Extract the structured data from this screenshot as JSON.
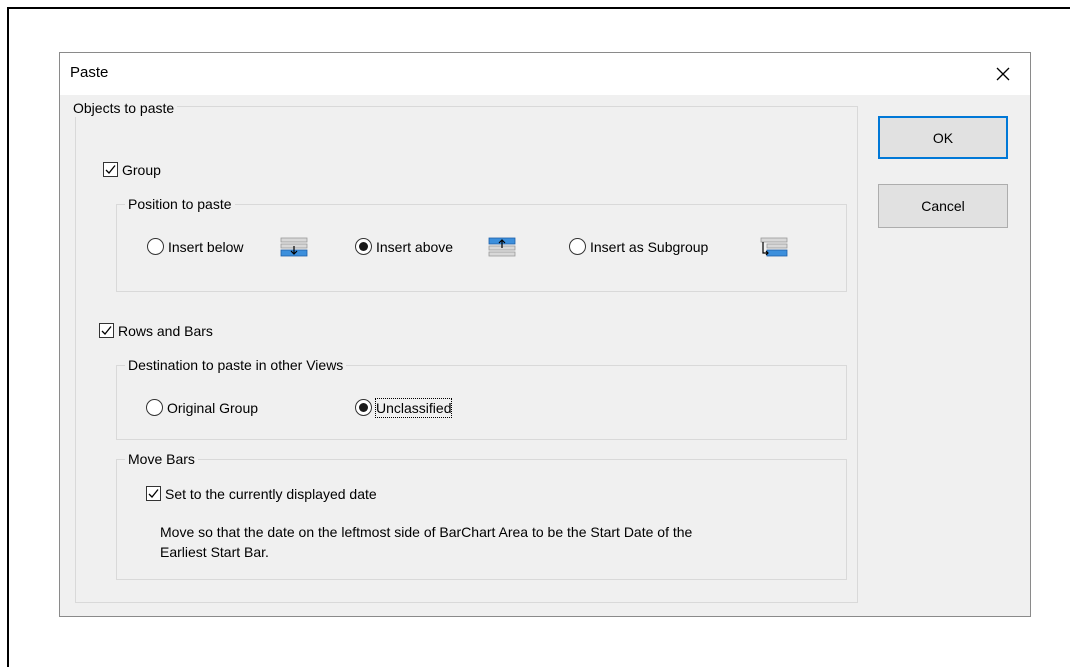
{
  "dialog": {
    "title": "Paste",
    "close_label": "×"
  },
  "objects_to_paste": {
    "legend": "Objects to paste",
    "group": {
      "checkbox_label": "Group",
      "checked": true,
      "position_legend": "Position to paste",
      "options": [
        {
          "label": "Insert below",
          "selected": false,
          "icon": "insert-below-icon"
        },
        {
          "label": "Insert above",
          "selected": true,
          "icon": "insert-above-icon"
        },
        {
          "label": "Insert as Subgroup",
          "selected": false,
          "icon": "insert-subgroup-icon"
        }
      ]
    },
    "rows_and_bars": {
      "checkbox_label": "Rows and Bars",
      "checked": true,
      "destination_legend": "Destination to paste in other Views",
      "destination_options": [
        {
          "label": "Original Group",
          "selected": false
        },
        {
          "label": "Unclassified",
          "selected": true
        }
      ],
      "move_bars": {
        "legend": "Move Bars",
        "checkbox_label": "Set to the currently displayed date",
        "checked": true,
        "description_line1": "Move so that the date on the leftmost side of BarChart Area to be the Start Date of the",
        "description_line2": "Earliest Start Bar."
      }
    }
  },
  "buttons": {
    "ok_label": "OK",
    "cancel_label": "Cancel"
  },
  "colors": {
    "accent": "#0078d7",
    "icon_blue": "#3c8fdc"
  }
}
